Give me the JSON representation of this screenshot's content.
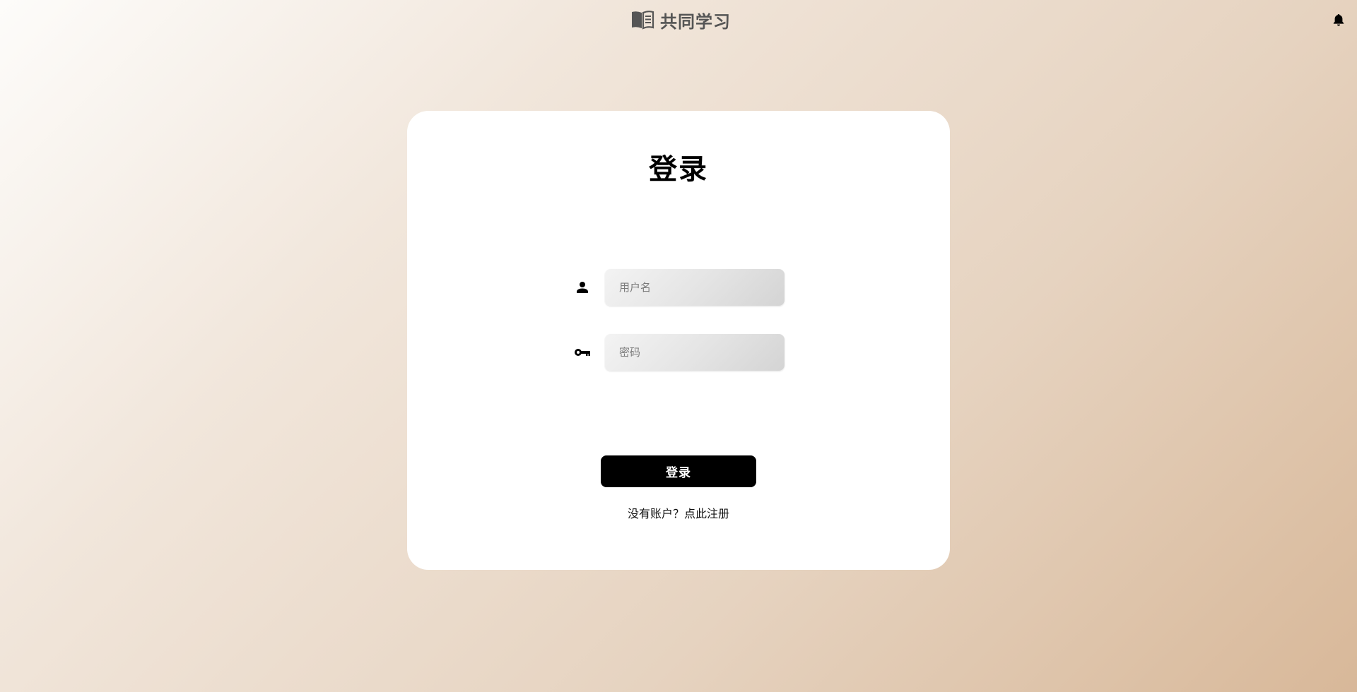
{
  "header": {
    "brand_icon": "book-icon",
    "brand_text": "共同学习",
    "notification_icon": "bell-icon"
  },
  "login": {
    "title": "登录",
    "username": {
      "icon": "user-icon",
      "placeholder": "用户名",
      "value": ""
    },
    "password": {
      "icon": "key-icon",
      "placeholder": "密码",
      "value": ""
    },
    "submit_label": "登录",
    "register_prompt": "没有账户？",
    "register_link": "点此注册"
  },
  "colors": {
    "background_start": "#fdfcfa",
    "background_end": "#d8b899",
    "card": "#ffffff",
    "button": "#000000",
    "brand_text": "#555555"
  }
}
